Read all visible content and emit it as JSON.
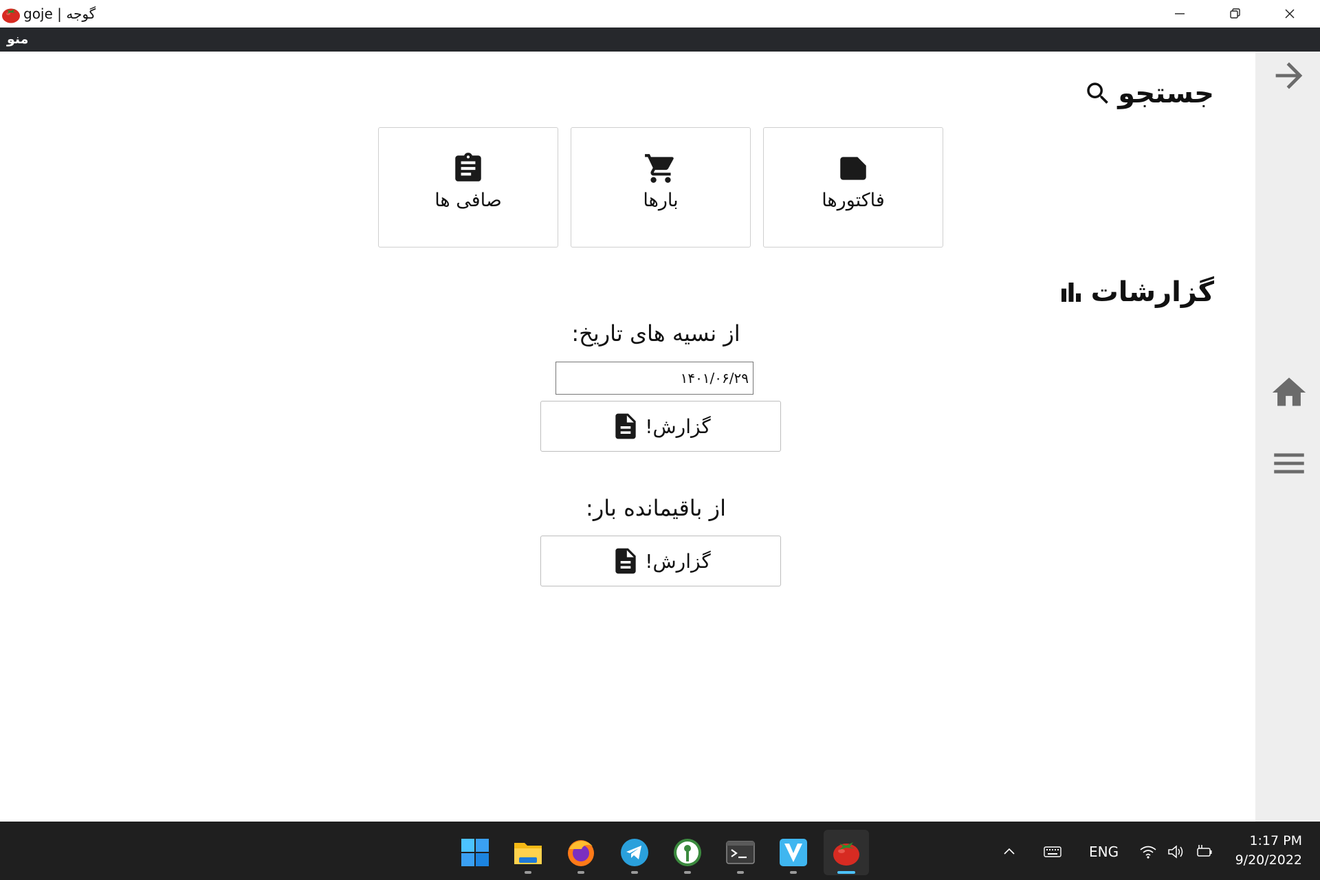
{
  "window": {
    "title": "goje | گوجه",
    "app_icon": "tomato-icon",
    "minimize_icon": "minimize-icon",
    "restore_icon": "restore-icon",
    "close_icon": "close-icon"
  },
  "menubar": {
    "menu_label": "منو"
  },
  "sidebar": {
    "items": [
      {
        "icon": "arrow-right-icon"
      },
      {
        "icon": "home-icon"
      },
      {
        "icon": "hamburger-menu-icon"
      }
    ]
  },
  "search": {
    "heading": "جستجو",
    "heading_icon": "search-icon",
    "cards": [
      {
        "label": "فاکتورها",
        "icon": "label-tag-icon"
      },
      {
        "label": "بارها",
        "icon": "shopping-cart-icon"
      },
      {
        "label": "صافی ها",
        "icon": "clipboard-icon"
      }
    ]
  },
  "reports": {
    "heading": "گزارشات",
    "heading_icon": "bar-chart-icon",
    "credit_report": {
      "title": "از نسیه های تاریخ:",
      "date_value": "۱۴۰۱/۰۶/۲۹",
      "button_label": "گزارش!",
      "button_icon": "document-icon"
    },
    "remaining_report": {
      "title": "از باقیمانده بار:",
      "button_label": "گزارش!",
      "button_icon": "document-icon"
    }
  },
  "taskbar": {
    "apps": [
      {
        "name": "windows-start-icon"
      },
      {
        "name": "file-explorer-icon"
      },
      {
        "name": "firefox-icon"
      },
      {
        "name": "telegram-icon"
      },
      {
        "name": "keepass-icon"
      },
      {
        "name": "terminal-icon"
      },
      {
        "name": "vuetify-icon"
      },
      {
        "name": "goje-tomato-icon",
        "active": true
      }
    ],
    "tray": {
      "language": "ENG",
      "time": "1:17 PM",
      "date": "9/20/2022"
    }
  },
  "colors": {
    "menubar_bg": "#26282c",
    "sidepanel_bg": "#eeeeee",
    "taskbar_bg": "#1f1f1f",
    "active_indicator": "#4cc2ff",
    "tomato_red": "#d72b22"
  }
}
